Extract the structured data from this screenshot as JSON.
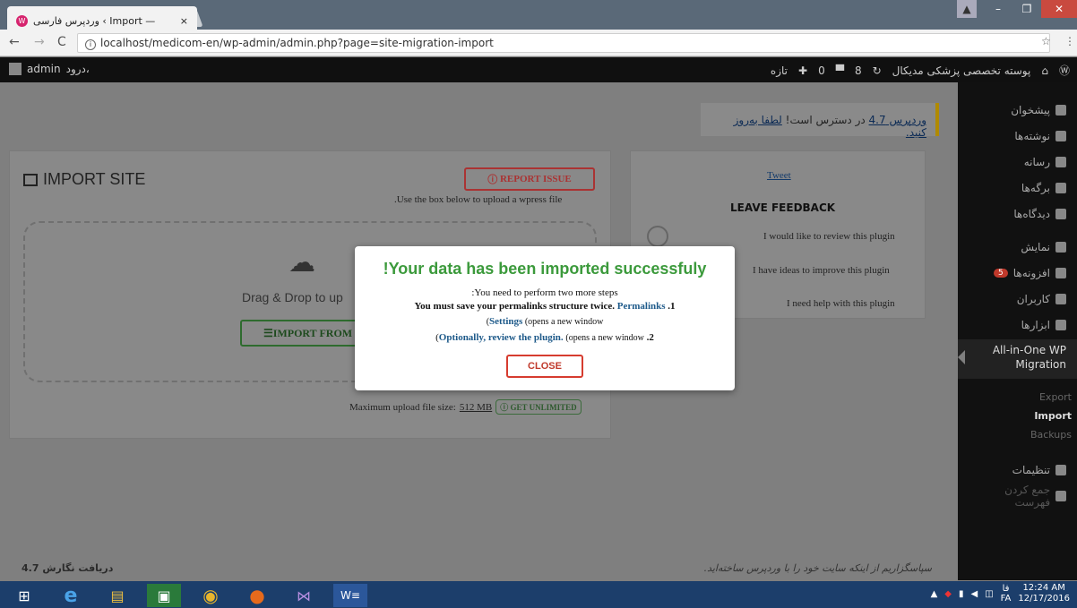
{
  "browser": {
    "tab_title": "وردپرس فارسی ‹ Import —",
    "tab_close": "×",
    "url": "localhost/medicom-en/wp-admin/admin.php?page=site-migration-import"
  },
  "adminbar": {
    "site_name": "پوسته تخصصی پزشکی مدیکال",
    "updates_count": "8",
    "comments_count": "0",
    "new_label": "تازه",
    "greeting": "درود،",
    "user": "admin"
  },
  "sidebar": {
    "items": [
      {
        "label": "پیشخوان"
      },
      {
        "label": "نوشته‌ها"
      },
      {
        "label": "رسانه"
      },
      {
        "label": "برگه‌ها"
      },
      {
        "label": "دیدگاه‌ها"
      },
      {
        "label": "نمایش"
      },
      {
        "label": "افزونه‌ها",
        "badge": "5"
      },
      {
        "label": "کاربران"
      },
      {
        "label": "ابزارها"
      }
    ],
    "active_label": "All-in-One WP Migration",
    "sub": [
      "Export",
      "Import",
      "Backups"
    ],
    "after": [
      {
        "label": "تنظیمات"
      },
      {
        "label": "جمع کردن فهرست"
      }
    ]
  },
  "notice": {
    "link1": "وردپرس 4.7",
    "text": "در دسترس است!",
    "link2": "لطفا بەروز کنید."
  },
  "import": {
    "title": "IMPORT SITE",
    "report_label": "REPORT ISSUE",
    "use_box": ".Use the box below to upload a wpress file",
    "drag_text": "Drag & Drop to up",
    "import_from": "IMPORT FROM",
    "max_label": "Maximum upload file size:",
    "max_value": "512 MB",
    "unlimited": "GET UNLIMITED"
  },
  "feedback": {
    "tweet": "Tweet",
    "title": "LEAVE FEEDBACK",
    "options": [
      "I would like to review this plugin",
      "I have ideas to improve this plugin",
      "I need help with this plugin"
    ]
  },
  "modal": {
    "title": "!Your data has been imported successfuly",
    "line1": ":You need to perform two more steps",
    "line2_text": "You must save your permalinks structure twice.",
    "line2_link": "Permalinks",
    "line2_num": ".1",
    "line3_link": "Settings",
    "line3_text": "(opens a new window",
    "line3_open": "(",
    "line4_open": "(",
    "line4_link": "Optionally, review the plugin.",
    "line4_text": "(opens a new window",
    "line4_num": ".2",
    "close": "CLOSE"
  },
  "footer": {
    "version": "دریافت نگارش 4.7",
    "thanks": "سپاسگزاریم از اینکه سایت خود را با وردپرس ساخته‌اید."
  },
  "taskbar": {
    "lang": "FA",
    "time": "12:24 AM",
    "date": "12/17/2016",
    "kb": "فا"
  },
  "colors": {
    "success": "#3c9a3c",
    "danger": "#d63c2f",
    "link": "#1e5a8a"
  }
}
